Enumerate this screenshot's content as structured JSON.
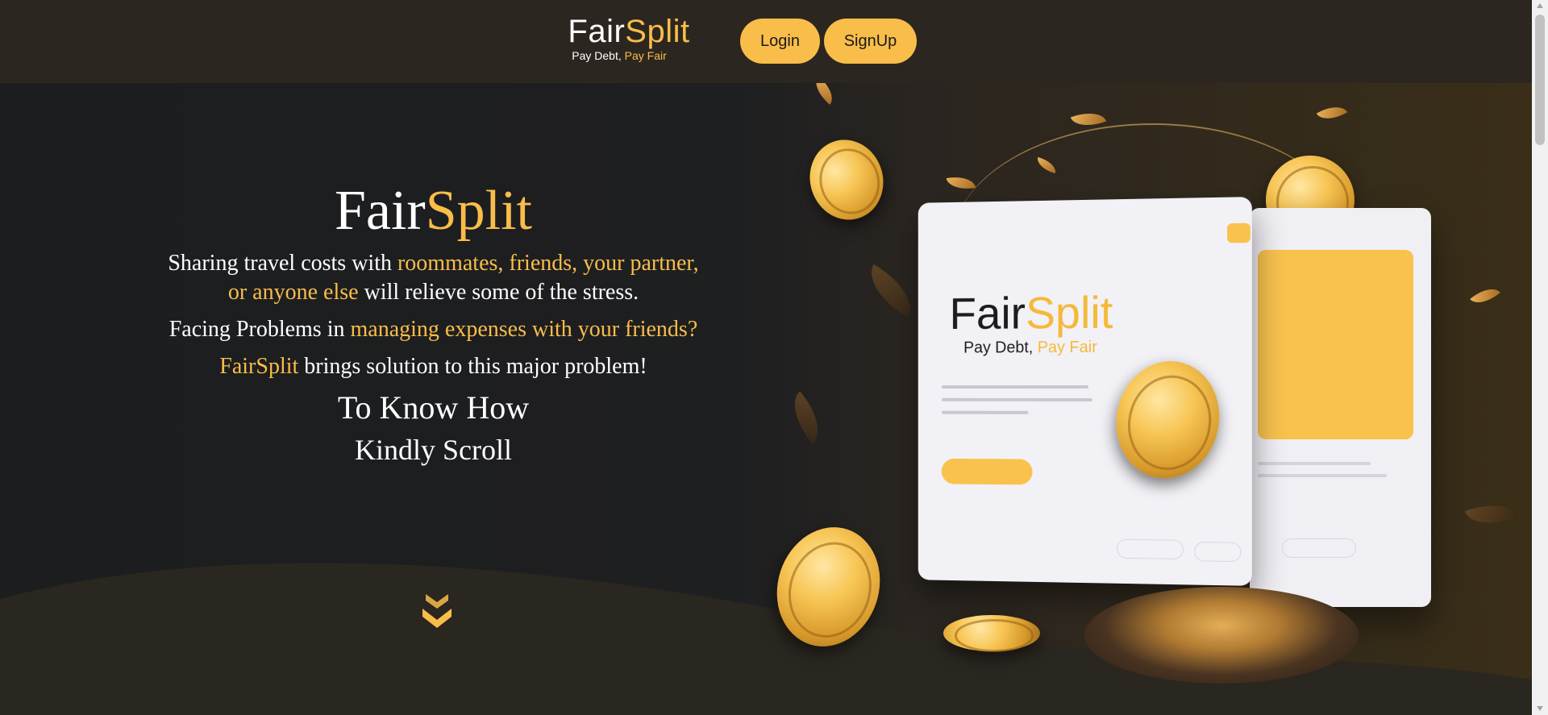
{
  "nav": {
    "brand_fair": "Fair",
    "brand_split": "Split",
    "tagline_a": "Pay Debt,",
    "tagline_b": "Pay Fair",
    "login_label": "Login",
    "signup_label": "SignUp"
  },
  "hero": {
    "title_fair": "Fair",
    "title_split": "Split",
    "p1_a": "Sharing travel costs with ",
    "p1_b": "roommates, friends, your partner, or anyone else",
    "p1_c": " will relieve some of the stress.",
    "p2_a": "Facing Problems in ",
    "p2_b": "managing expenses with your friends?",
    "p3_a": "FairSplit",
    "p3_b": " brings solution to this major problem!",
    "know": "To Know How",
    "scroll": "Kindly Scroll",
    "chevron_icon": "double-chevron-down-icon"
  },
  "illustration": {
    "card_logo_fair": "Fair",
    "card_logo_split": "Split",
    "card_tag_a": "Pay Debt,",
    "card_tag_b": " Pay Fair"
  },
  "colors": {
    "accent": "#f9bd4a",
    "nav_bg": "#2b2620",
    "hero_bg": "#1c1d1f"
  }
}
